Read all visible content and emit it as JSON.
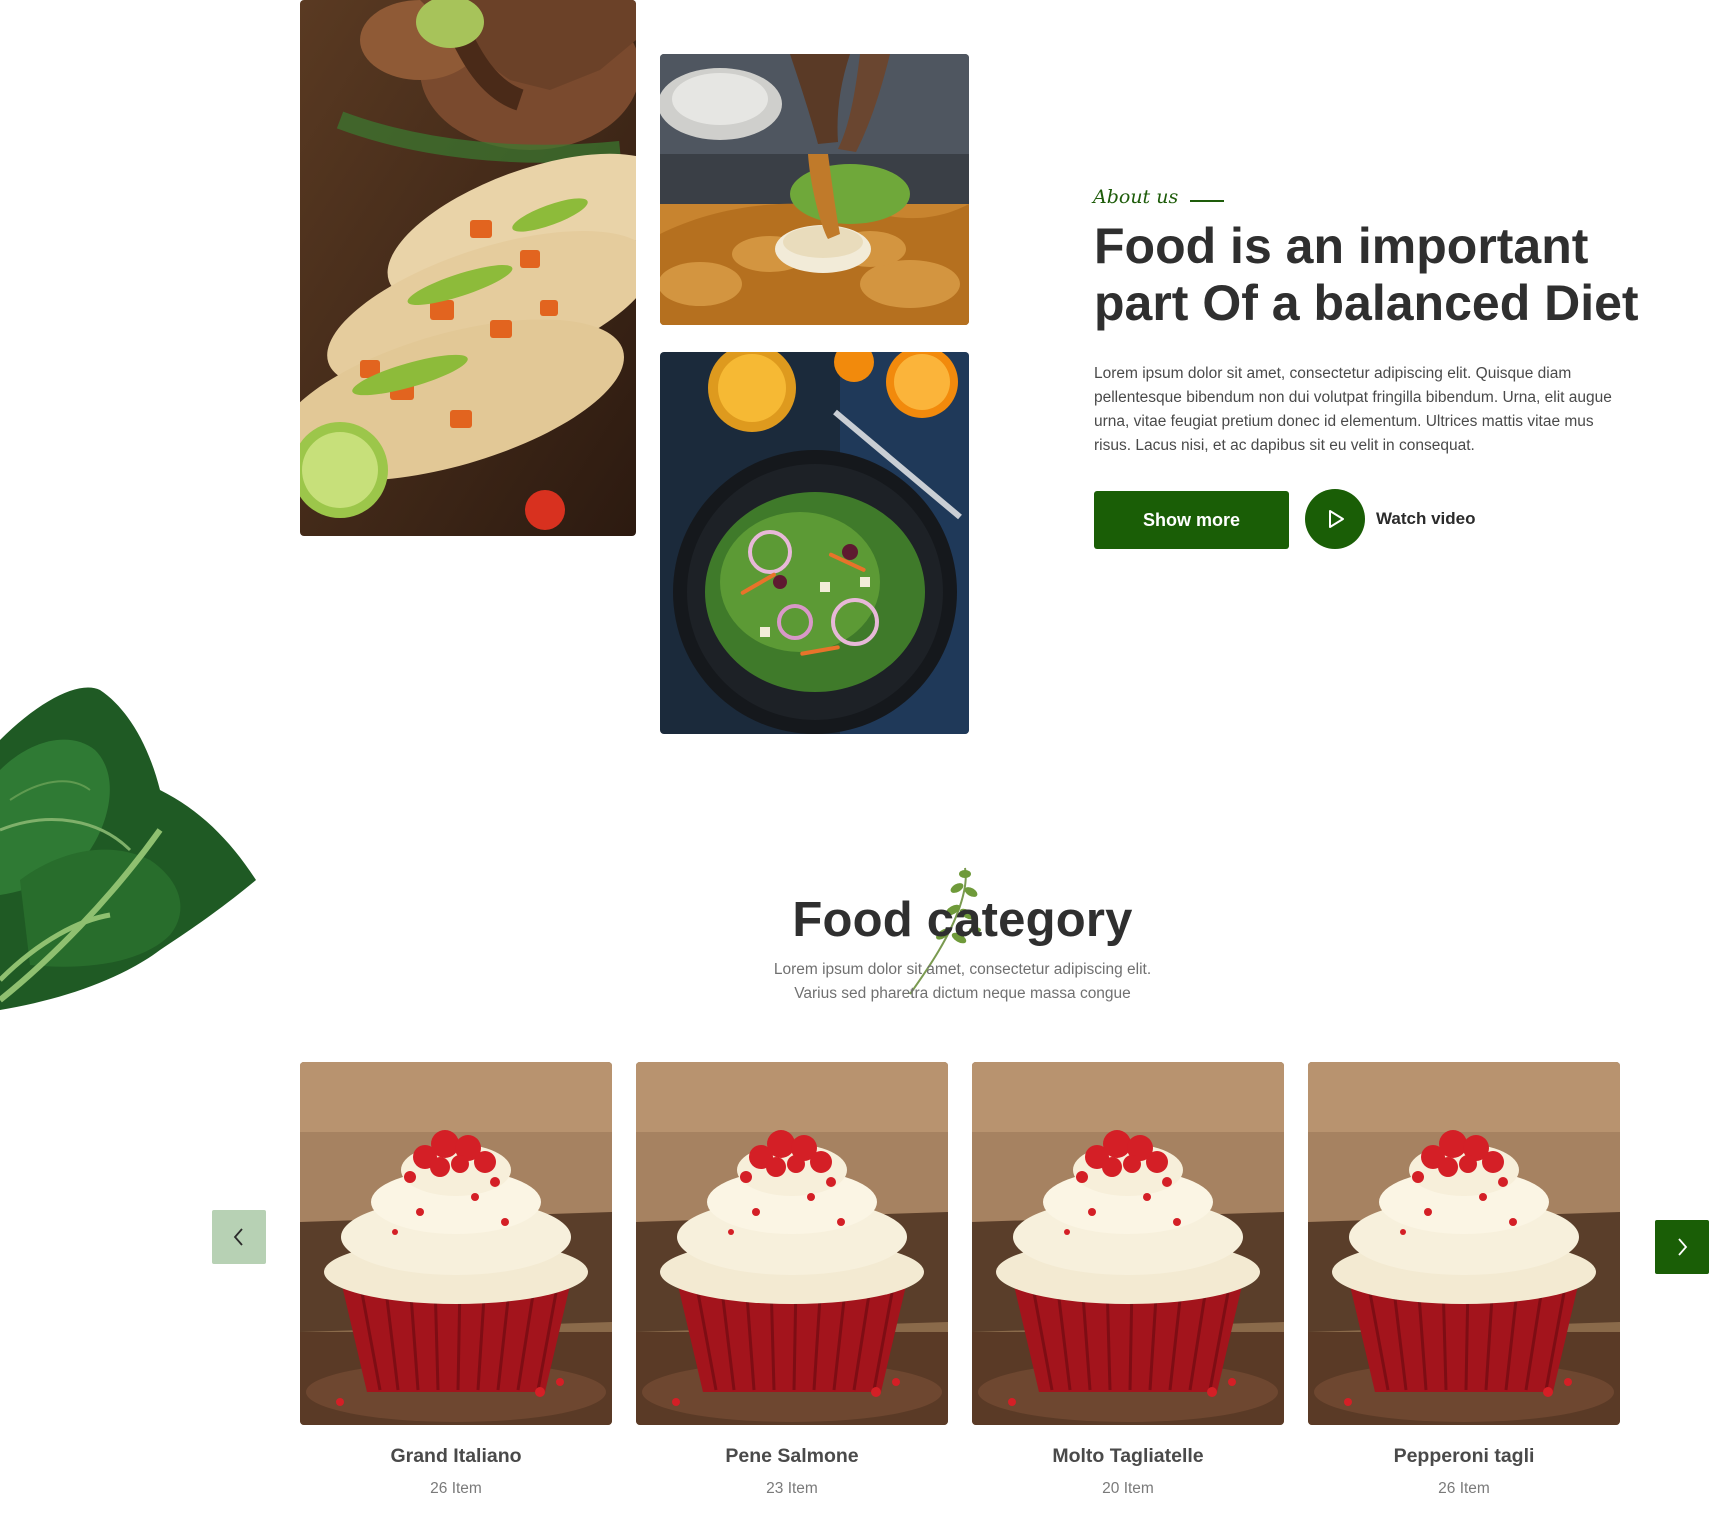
{
  "about": {
    "tag": "About us",
    "title_line1": "Food is an important",
    "title_line2": "part Of a balanced Diet",
    "description": "Lorem ipsum dolor sit amet, consectetur adipiscing elit. Quisque diam pellentesque bibendum non dui volutpat fringilla bibendum. Urna, elit augue urna, vitae feugiat pretium donec id elementum. Ultrices mattis vitae mus risus. Lacus nisi, et ac dapibus sit eu velit in consequat.",
    "show_more_label": "Show more",
    "watch_video_label": "Watch video"
  },
  "category": {
    "title": "Food category",
    "subtitle_line1": "Lorem ipsum dolor sit amet, consectetur adipiscing elit.",
    "subtitle_line2": "Varius sed pharetra dictum neque massa congue",
    "items": [
      {
        "name": "Grand Italiano",
        "count": "26 Item"
      },
      {
        "name": "Pene Salmone",
        "count": "23 Item"
      },
      {
        "name": "Molto Tagliatelle",
        "count": "20 Item"
      },
      {
        "name": "Pepperoni tagli",
        "count": "26 Item"
      }
    ]
  },
  "icons": {
    "play": "play-icon",
    "prev": "chevron-left-icon",
    "next": "chevron-right-icon"
  },
  "colors": {
    "primary": "#1a5e06",
    "arrow_inactive": "#b7d1b4",
    "text_dark": "#2f2f2f",
    "text_muted": "#707070"
  }
}
